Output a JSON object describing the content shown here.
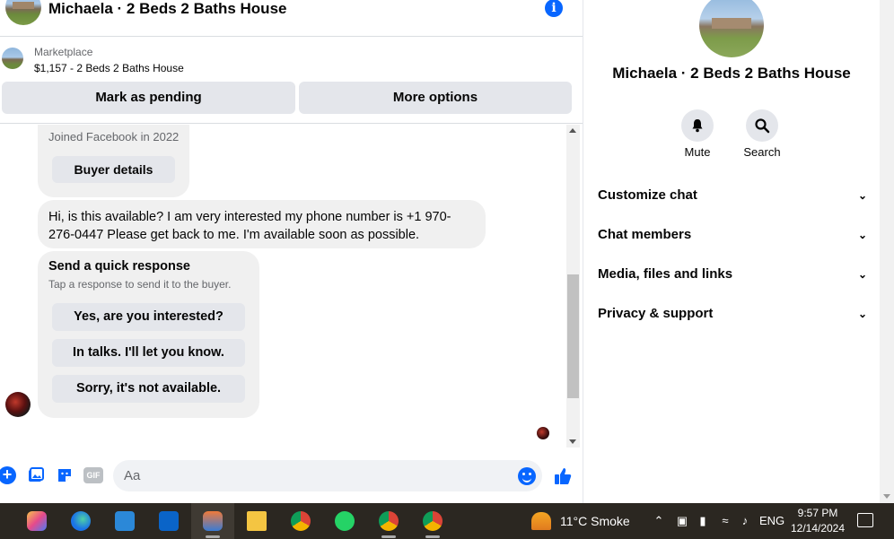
{
  "chat": {
    "title": "Michaela · 2 Beds 2 Baths House",
    "marketplace_label": "Marketplace",
    "listing": "$1,157 - 2 Beds 2 Baths House",
    "mark_pending": "Mark as pending",
    "more_options": "More options",
    "joined": "Joined Facebook in 2022",
    "buyer_details": "Buyer details",
    "message": "Hi, is this available? I am very interested my phone number is +1 970-276-0447 Please get back to me. I'm available soon as possible.",
    "quick_title": "Send a quick response",
    "quick_sub": "Tap a response to send it to the buyer.",
    "quick_responses": [
      "Yes, are you interested?",
      "In talks. I'll let you know.",
      "Sorry, it's not available."
    ],
    "input_placeholder": "Aa"
  },
  "details": {
    "title": "Michaela · 2 Beds 2 Baths House",
    "mute": "Mute",
    "search": "Search",
    "sections": [
      "Customize chat",
      "Chat members",
      "Media, files and links",
      "Privacy & support"
    ]
  },
  "taskbar": {
    "weather": "11°C  Smoke",
    "lang": "ENG",
    "time": "9:57 PM",
    "date": "12/14/2024",
    "apps": [
      "copilot-icon",
      "edge-icon",
      "store-icon",
      "outlook-icon",
      "app-icon",
      "file-explorer-icon",
      "chrome-icon",
      "whatsapp-icon",
      "chrome-profile-c-icon",
      "chrome-profile-icon"
    ]
  },
  "colors": {
    "accent": "#0866ff",
    "bubble": "#f0f0f0",
    "button": "#e4e6eb",
    "taskbar": "#2b2721"
  }
}
